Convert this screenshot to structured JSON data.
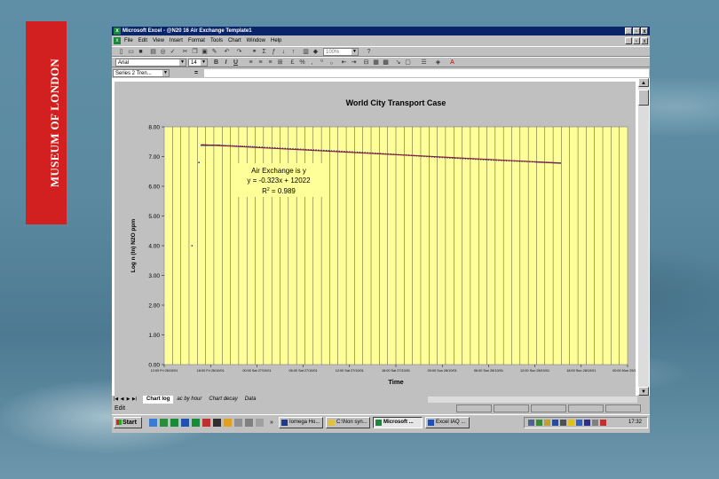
{
  "side_tag": {
    "text": "MUSEUM OF LONDON"
  },
  "window": {
    "title": "Microsoft Excel - @N20 16 Air Exchange Template1",
    "minimize": "_",
    "restore": "▫",
    "close": "x"
  },
  "menu": {
    "items": [
      "File",
      "Edit",
      "View",
      "Insert",
      "Format",
      "Tools",
      "Chart",
      "Window",
      "Help"
    ],
    "minimize": "_",
    "restore": "▫",
    "close": "x"
  },
  "toolbar": {
    "zoom": "100%",
    "font": "Arial",
    "size": "14",
    "bold": "B",
    "italic": "I",
    "underline": "U"
  },
  "formula_bar": {
    "name_box": "Series 2 Tren...",
    "equals": "="
  },
  "chart_data": {
    "type": "scatter",
    "title": "World City Transport Case",
    "xlabel": "Time",
    "ylabel": "Log n (ln) N2O ppm",
    "ylim": [
      0,
      8
    ],
    "yticks": [
      "0.00",
      "1.00",
      "2.00",
      "3.00",
      "4.00",
      "5.00",
      "6.00",
      "7.00",
      "8.00"
    ],
    "xticks": [
      "12:00 Fri 26/10/01",
      "18:00 Fri 26/10/01",
      "00:00 Sat 27/10/01",
      "06:00 Sat 27/10/01",
      "12:00 Sat 27/10/01",
      "18:00 Sat 27/10/01",
      "00:00 Sun 28/10/01",
      "06:00 Sun 28/10/01",
      "12:00 Sun 28/10/01",
      "18:00 Sun 28/10/01",
      "00:00 Mon 29/10/01"
    ],
    "plot_background": "#ffff99",
    "grid": "vertical",
    "series": [
      {
        "color": "#1f3a93",
        "points": [
          {
            "x": 0.06,
            "y": 4.0
          },
          {
            "x": 0.075,
            "y": 6.8
          },
          {
            "x": 0.08,
            "y": 7.38
          },
          {
            "x": 0.12,
            "y": 7.38
          },
          {
            "x": 0.2,
            "y": 7.32
          },
          {
            "x": 0.3,
            "y": 7.24
          },
          {
            "x": 0.4,
            "y": 7.16
          },
          {
            "x": 0.5,
            "y": 7.07
          },
          {
            "x": 0.6,
            "y": 6.97
          },
          {
            "x": 0.7,
            "y": 6.89
          },
          {
            "x": 0.8,
            "y": 6.82
          },
          {
            "x": 0.855,
            "y": 6.78
          }
        ]
      }
    ],
    "trendline": {
      "color": "#8b1a3a",
      "x": [
        0.08,
        0.855
      ],
      "y": [
        7.4,
        6.78
      ]
    },
    "annotation": {
      "line1": "Air Exchange is y",
      "line2": "y = -0.323x + 12022",
      "r2_label": "R",
      "r2_sup": "2",
      "r2_value": " = 0.989"
    }
  },
  "sheet_tabs": {
    "nav": [
      "|◀",
      "◀",
      "▶",
      "▶|"
    ],
    "items": [
      "Chart log",
      "ac by hour",
      "Chart decay",
      "Data"
    ],
    "active": "Chart log"
  },
  "status": {
    "mode": "Edit"
  },
  "taskbar": {
    "start": "Start",
    "tasks": [
      "Iomega Ho...",
      "C:\\Non syn...",
      "Microsoft ...",
      "Excel IAQ ..."
    ],
    "active_task": "Microsoft ...",
    "clock": "17:32",
    "chevron": "»"
  }
}
